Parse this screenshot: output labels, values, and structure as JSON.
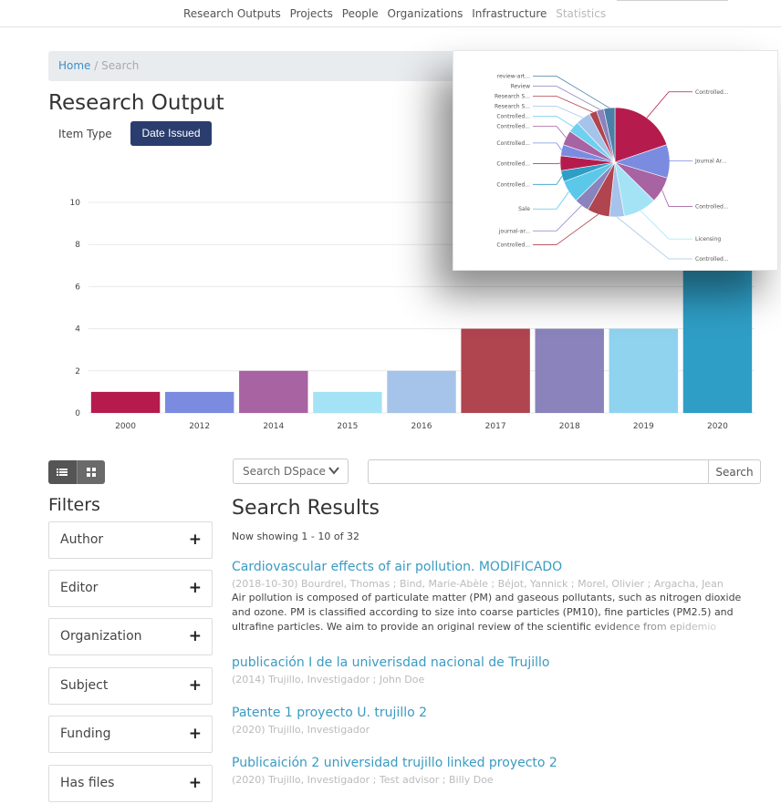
{
  "nav": {
    "items": [
      "Research Outputs",
      "Projects",
      "People",
      "Organizations",
      "Infrastructure",
      "Statistics"
    ]
  },
  "breadcrumb": {
    "home": "Home",
    "separator": "/",
    "current": "Search"
  },
  "research_output": {
    "title": "Research Output",
    "item_type_label": "Item Type",
    "date_issued_label": "Date Issued"
  },
  "chart_data": [
    {
      "type": "bar",
      "categories": [
        "2000",
        "2012",
        "2014",
        "2015",
        "2016",
        "2017",
        "2018",
        "2019",
        "2020"
      ],
      "values": [
        1,
        1,
        2,
        1,
        2,
        4,
        4,
        4,
        7
      ],
      "colors": [
        "#b51c4d",
        "#7b8ce0",
        "#a863a3",
        "#a4e3f5",
        "#a6c3ea",
        "#b0444f",
        "#8a83bc",
        "#8fd3ef",
        "#2f9ec6"
      ],
      "yticks": [
        "0",
        "2",
        "4",
        "6",
        "8",
        "10"
      ],
      "ylim": [
        0,
        10
      ],
      "grid": true
    },
    {
      "type": "pie",
      "labels": [
        "Controlled...",
        "Journal Ar...",
        "Controlled...",
        "Licensing",
        "Controlled...",
        "Controlled...",
        "journal-ar...",
        "Sale",
        "Controlled...",
        "Controlled...",
        "Controlled...",
        "Controlled...",
        "Controlled...",
        "Research S...",
        "Research S...",
        "Review",
        "review-art..."
      ],
      "values": [
        18,
        9,
        7,
        9,
        4,
        6,
        4,
        6,
        3,
        4,
        3,
        4,
        3,
        4,
        2,
        2,
        3
      ],
      "colors": [
        "#b51c4d",
        "#7b8ce0",
        "#a863a3",
        "#a4e3f5",
        "#a6c3ea",
        "#b0444f",
        "#8a83bc",
        "#5bc8ea",
        "#2f9ec6",
        "#b51c4d",
        "#7b8ce0",
        "#a863a3",
        "#6fd0ef",
        "#a6c3ea",
        "#b0444f",
        "#8a83bc",
        "#4a7fa8"
      ]
    }
  ],
  "view_toggle": {
    "list_icon": "list-icon",
    "grid_icon": "grid-icon"
  },
  "filters": {
    "title": "Filters",
    "items": [
      "Author",
      "Editor",
      "Organization",
      "Subject",
      "Funding",
      "Has files"
    ],
    "expand_symbol": "+"
  },
  "search": {
    "scope": "Search DSpace",
    "query": "",
    "button": "Search"
  },
  "results": {
    "title": "Search Results",
    "showing": "Now showing 1 - 10 of 32",
    "items": [
      {
        "title": "Cardiovascular effects of air pollution. MODIFICADO",
        "meta": "(2018-10-30) Bourdrel, Thomas ; Bind, Marie-Abèle ; Béjot, Yannick ; Morel, Olivier ; Argacha, Jean",
        "abstract": "Air pollution is composed of particulate matter (PM) and gaseous pollutants, such as nitrogen dioxide and ozone. PM is classified according to size into coarse particles (PM10), fine particles (PM2.5) and ultrafine particles. We aim to provide an original review of the scientific evidence from epidemio"
      },
      {
        "title": "publicación I de la univerisdad nacional de Trujillo",
        "meta": "(2014) Trujillo, Investigador ; John Doe",
        "abstract": ""
      },
      {
        "title": "Patente 1 proyecto U. trujillo 2",
        "meta": "(2020) Trujillo, Investigador",
        "abstract": ""
      },
      {
        "title": "Publicaición 2 universidad trujillo linked proyecto 2",
        "meta": "(2020) Trujillo, Investigador ; Test advisor ; Billy Doe",
        "abstract": ""
      }
    ]
  }
}
